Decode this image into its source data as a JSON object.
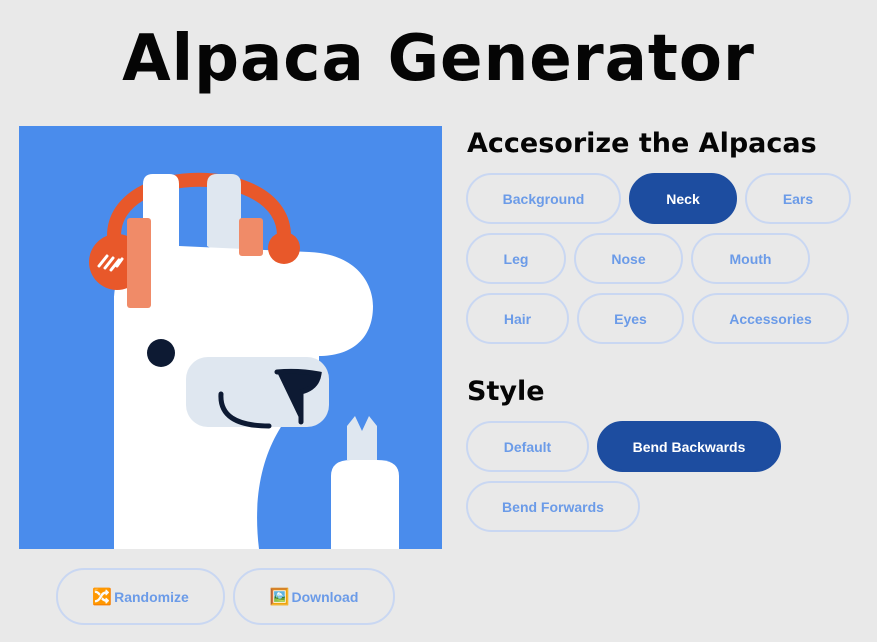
{
  "title": "Alpaca Generator",
  "accessorize": {
    "heading": "Accesorize the Alpacas",
    "items": [
      {
        "label": "Background",
        "active": false
      },
      {
        "label": "Neck",
        "active": true
      },
      {
        "label": "Ears",
        "active": false
      },
      {
        "label": "Leg",
        "active": false
      },
      {
        "label": "Nose",
        "active": false
      },
      {
        "label": "Mouth",
        "active": false
      },
      {
        "label": "Hair",
        "active": false
      },
      {
        "label": "Eyes",
        "active": false
      },
      {
        "label": "Accessories",
        "active": false
      }
    ]
  },
  "style": {
    "heading": "Style",
    "items": [
      {
        "label": "Default",
        "active": false
      },
      {
        "label": "Bend Backwards",
        "active": true
      },
      {
        "label": "Bend Forwards",
        "active": false
      }
    ]
  },
  "actions": {
    "randomize": {
      "label": "Randomize",
      "icon": "🔀"
    },
    "download": {
      "label": "Download",
      "icon": "🖼️"
    }
  },
  "colors": {
    "background": "#4a8cec",
    "active_pill": "#1d4da0",
    "pill_text": "#6b9be8",
    "headphones": "#e8582a"
  }
}
